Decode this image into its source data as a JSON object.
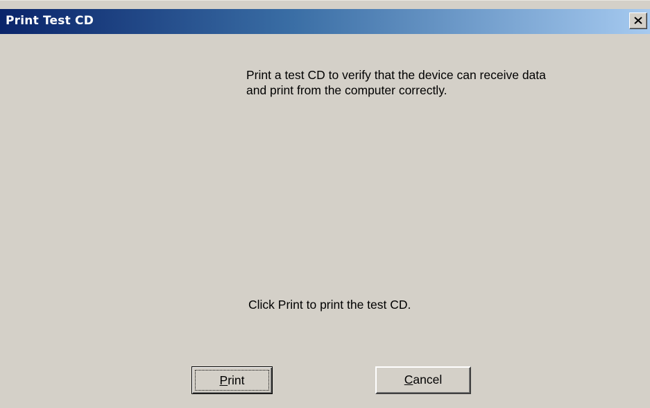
{
  "window": {
    "title": "Print Test CD",
    "close_symbol": "close-icon"
  },
  "content": {
    "description_line1": "Print a test CD to verify that the device can receive data",
    "description_line2": "and print from the computer correctly.",
    "instruction": "Click Print to print the test CD."
  },
  "buttons": {
    "print": {
      "mnemonic": "P",
      "rest": "rint"
    },
    "cancel": {
      "mnemonic": "C",
      "rest": "ancel"
    }
  },
  "colors": {
    "face": "#d4d0c8",
    "title_start": "#0a246a",
    "title_end": "#a6caf0"
  }
}
